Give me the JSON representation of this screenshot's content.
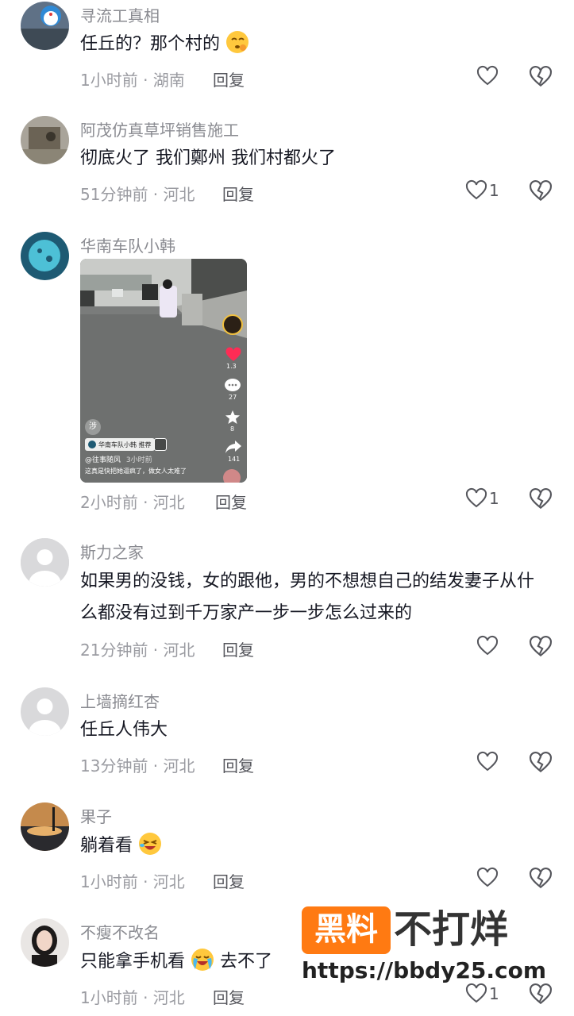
{
  "comments": [
    {
      "username": "寻流工真相",
      "text": "任丘的？那个村的",
      "emoji": "thinking-emoji",
      "time_loc": "1小时前 · 湖南",
      "reply": "回复",
      "likes": ""
    },
    {
      "username": "阿茂仿真草坪销售施工",
      "text": "彻底火了  我们鄭州  我们村都火了",
      "time_loc": "51分钟前 · 河北",
      "reply": "回复",
      "likes": "1"
    },
    {
      "username": "华南车队小韩",
      "text": "",
      "time_loc": "2小时前 · 河北",
      "reply": "回复",
      "likes": "1"
    },
    {
      "username": "斯力之家",
      "text": "如果男的没钱，女的跟他，男的不想想自己的结发妻子从什么都没有过到千万家产一步一步怎么过来的",
      "time_loc": "21分钟前 · 河北",
      "reply": "回复",
      "likes": ""
    },
    {
      "username": "上墙摘红杏",
      "text": "任丘人伟大",
      "time_loc": "13分钟前 · 河北",
      "reply": "回复",
      "likes": ""
    },
    {
      "username": "果子",
      "text": "躺着看",
      "emoji": "laughing-emoji",
      "time_loc": "1小时前 · 河北",
      "reply": "回复",
      "likes": ""
    },
    {
      "username": "不瘦不改名",
      "text": "只能拿手机看",
      "text_after": "去不了",
      "emoji": "crying-emoji",
      "time_loc": "1小时前 · 河北",
      "reply": "回复",
      "likes": "1"
    }
  ],
  "video_card": {
    "tag_label": "华南车队小韩 推荐",
    "author": "@往事随风",
    "author_time": "3小时前",
    "caption": "这真是快把她逼疯了，做女人太难了",
    "like_count": "1.3",
    "comment_count": "27",
    "fav_count": "8",
    "share_count": "141",
    "play_glyph": "涉"
  },
  "watermark": {
    "box_text": "黑料",
    "text": "不打烊",
    "url": "https://bbdy25.com"
  },
  "colors": {
    "username": "#8a8b91",
    "text": "#161823",
    "accent": "#ff7a12",
    "like_red": "#fe2c55"
  }
}
